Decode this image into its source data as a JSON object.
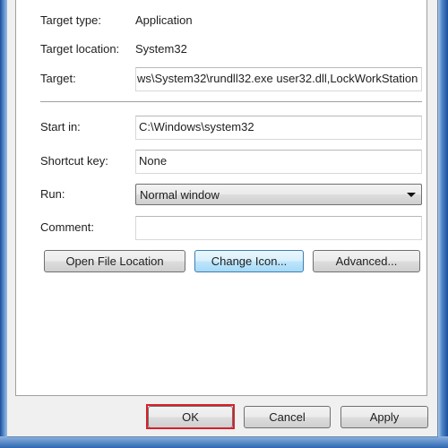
{
  "fields": {
    "target_type": {
      "label": "Target type:",
      "value": "Application"
    },
    "target_location": {
      "label": "Target location:",
      "value": "System32"
    },
    "target": {
      "label": "Target:",
      "value": "ws\\System32\\rundll32.exe user32.dll,LockWorkStation"
    },
    "start_in": {
      "label": "Start in:",
      "value": "C:\\Windows\\system32"
    },
    "shortcut_key": {
      "label": "Shortcut key:",
      "value": "None"
    },
    "run": {
      "label": "Run:",
      "value": "Normal window"
    },
    "comment": {
      "label": "Comment:",
      "value": ""
    }
  },
  "buttons": {
    "open_file_location": "Open File Location",
    "change_icon": "Change Icon...",
    "advanced": "Advanced...",
    "ok": "OK",
    "cancel": "Cancel",
    "apply": "Apply"
  },
  "highlight_color": "#d8202a"
}
